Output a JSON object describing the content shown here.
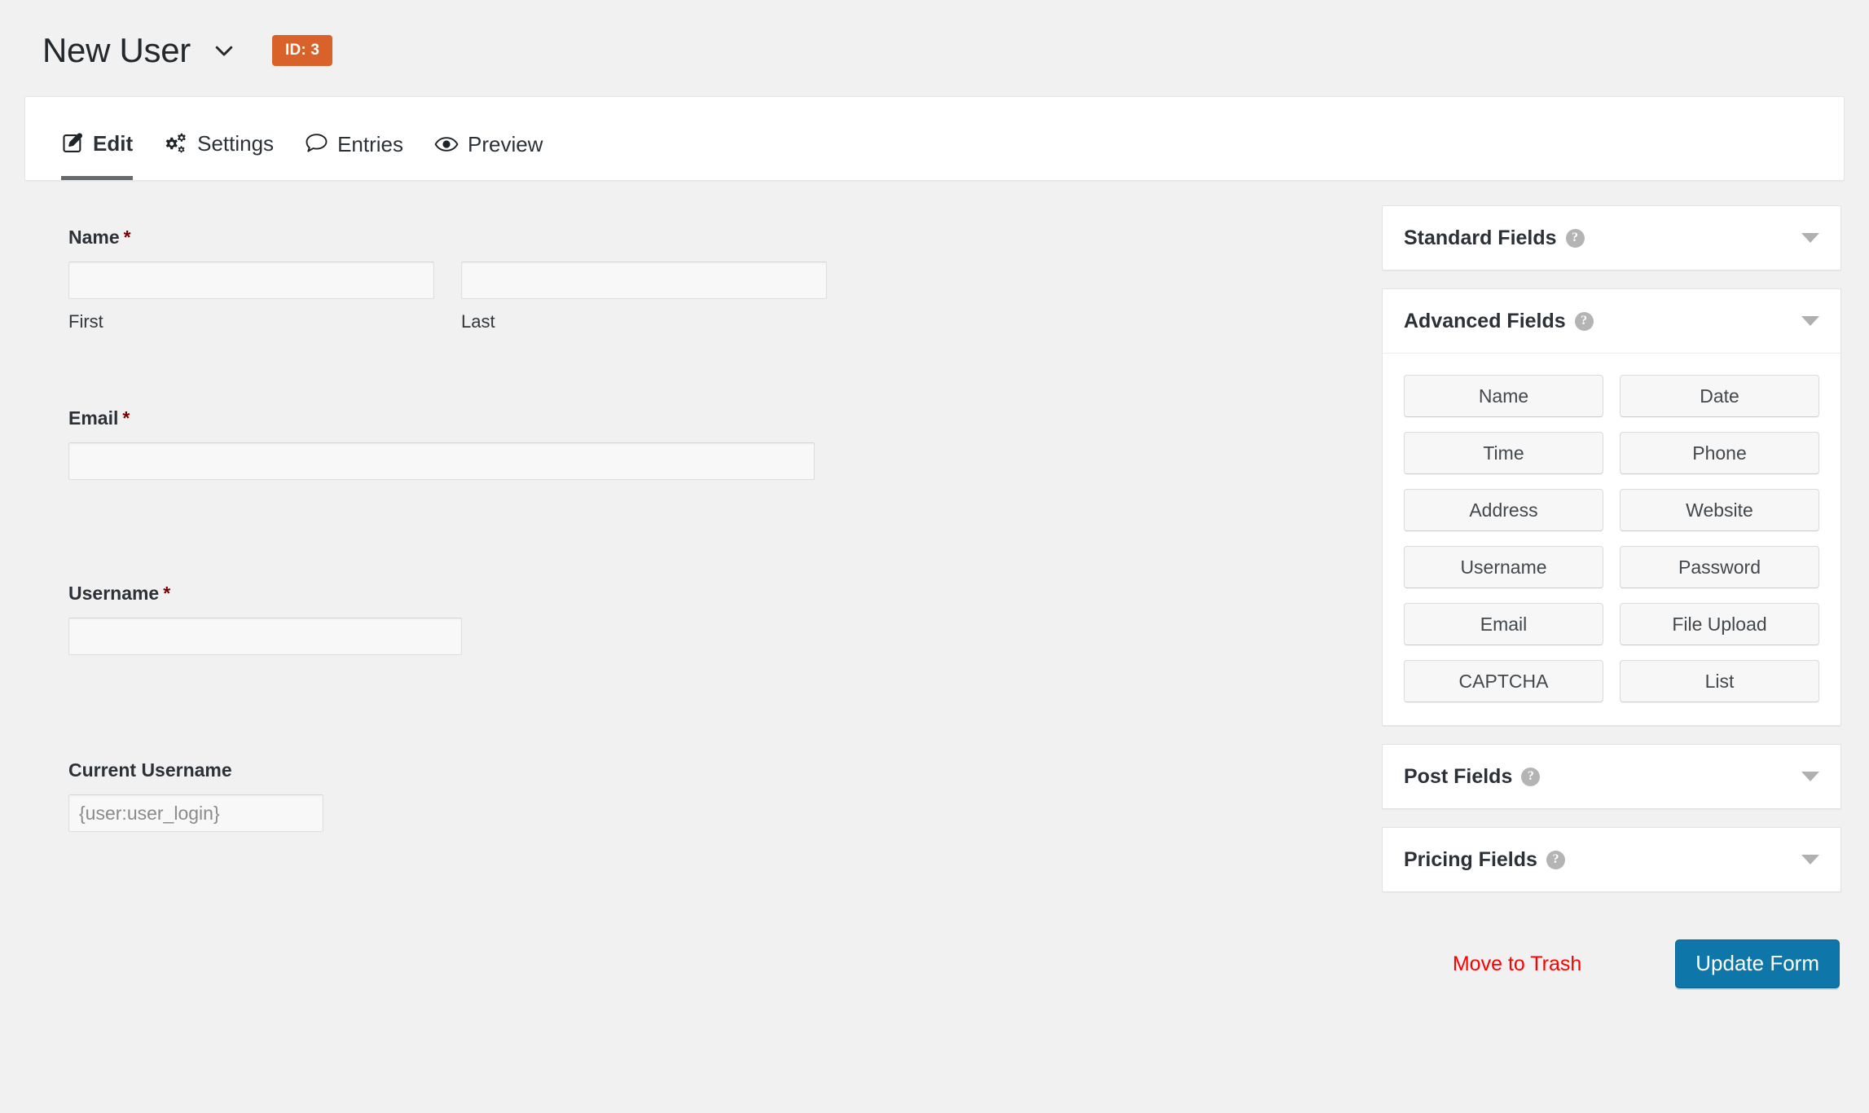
{
  "header": {
    "title": "New User",
    "chevron_icon": "chevron-down-icon",
    "id_badge": "ID: 3",
    "badge_color": "#d9622b"
  },
  "tabs": [
    {
      "label": "Edit",
      "icon": "edit-pencil-icon",
      "active": true
    },
    {
      "label": "Settings",
      "icon": "gears-icon",
      "active": false
    },
    {
      "label": "Entries",
      "icon": "speech-bubble-icon",
      "active": false
    },
    {
      "label": "Preview",
      "icon": "eye-icon",
      "active": false
    }
  ],
  "form": {
    "name_field": {
      "label": "Name",
      "required_mark": "*",
      "first": {
        "sublabel": "First",
        "value": ""
      },
      "last": {
        "sublabel": "Last",
        "value": ""
      }
    },
    "email_field": {
      "label": "Email",
      "required_mark": "*",
      "value": ""
    },
    "username_field": {
      "label": "Username",
      "required_mark": "*",
      "value": ""
    },
    "current_username_field": {
      "label": "Current Username",
      "placeholder": "{user:user_login}",
      "value": ""
    }
  },
  "sidebar": {
    "panels": [
      {
        "title": "Standard Fields",
        "help_icon": "help-question-icon",
        "toggle_icon": "caret-down-icon",
        "expanded": false,
        "buttons": []
      },
      {
        "title": "Advanced Fields",
        "help_icon": "help-question-icon",
        "toggle_icon": "caret-down-icon",
        "expanded": true,
        "buttons": [
          "Name",
          "Date",
          "Time",
          "Phone",
          "Address",
          "Website",
          "Username",
          "Password",
          "Email",
          "File Upload",
          "CAPTCHA",
          "List"
        ]
      },
      {
        "title": "Post Fields",
        "help_icon": "help-question-icon",
        "toggle_icon": "caret-down-icon",
        "expanded": false,
        "buttons": []
      },
      {
        "title": "Pricing Fields",
        "help_icon": "help-question-icon",
        "toggle_icon": "caret-down-icon",
        "expanded": false,
        "buttons": []
      }
    ],
    "actions": {
      "trash_label": "Move to Trash",
      "trash_color": "#ff0000",
      "update_label": "Update Form",
      "update_color": "#0e76a8"
    }
  }
}
